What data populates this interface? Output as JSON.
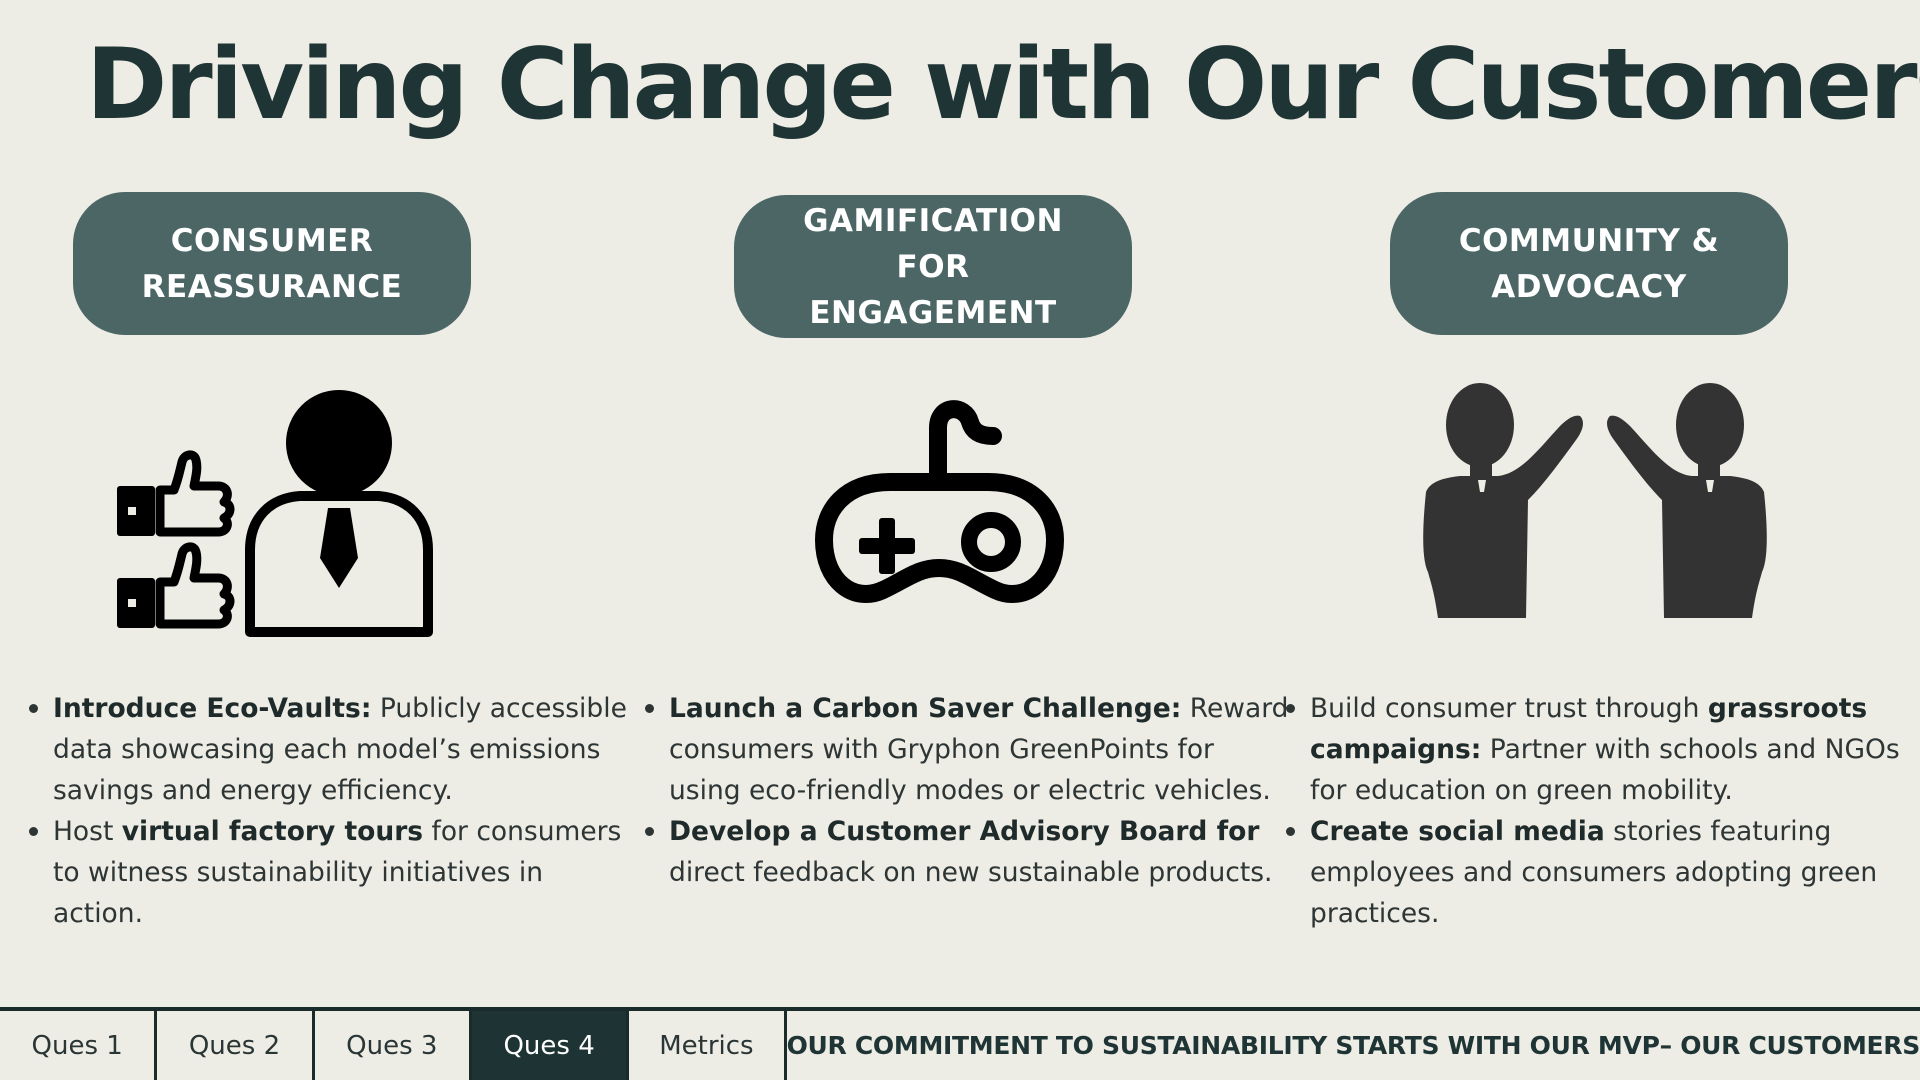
{
  "title": "Driving Change with Our Customers",
  "columns": [
    {
      "heading": [
        "CONSUMER",
        "REASSURANCE"
      ],
      "icon": "customer-approval-icon",
      "bullets": [
        {
          "bold_prefix": "Introduce Eco-Vaults:",
          "text": " Publicly accessible data showcasing each model’s emissions savings and energy efficiency.",
          "pre": "",
          "bold_mid": "",
          "post": ""
        },
        {
          "bold_prefix": "",
          "pre": "Host ",
          "bold_mid": "virtual factory tours",
          "post": " for consumers to witness sustainability initiatives in action.",
          "text": ""
        }
      ]
    },
    {
      "heading": [
        "GAMIFICATION FOR",
        "ENGAGEMENT"
      ],
      "icon": "game-controller-icon",
      "bullets": [
        {
          "bold_prefix": "Launch a Carbon Saver Challenge:",
          "text": " Reward consumers with Gryphon GreenPoints for using eco-friendly modes or electric vehicles.",
          "pre": "",
          "bold_mid": "",
          "post": ""
        },
        {
          "bold_prefix": "Develop a Customer Advisory Board for",
          "text": " direct feedback on new sustainable products.",
          "pre": "",
          "bold_mid": "",
          "post": ""
        }
      ]
    },
    {
      "heading": [
        "COMMUNITY &",
        "ADVOCACY"
      ],
      "icon": "high-five-icon",
      "bullets": [
        {
          "bold_prefix": "",
          "pre": "Build consumer trust through ",
          "bold_mid": "grassroots campaigns:",
          "post": " Partner with schools and NGOs for education on green mobility.",
          "text": ""
        },
        {
          "bold_prefix": "Create social media",
          "text": " stories featuring employees and consumers adopting green practices.",
          "pre": "",
          "bold_mid": "",
          "post": ""
        }
      ]
    }
  ],
  "footer": {
    "tabs": [
      "Ques 1",
      "Ques 2",
      "Ques 3",
      "Ques 4",
      "Metrics"
    ],
    "active_tab": "Ques 4",
    "tagline": "OUR COMMITMENT TO SUSTAINABILITY STARTS WITH OUR MVP– OUR CUSTOMERS"
  },
  "colors": {
    "background": "#edece5",
    "title": "#1f3435",
    "pill": "#4c6666",
    "active_tab": "#1e3434"
  }
}
